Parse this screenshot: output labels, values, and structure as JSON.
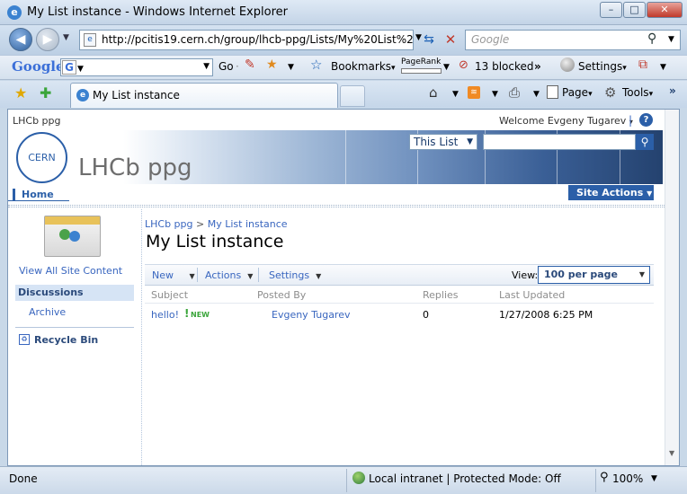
{
  "window": {
    "title": "My List instance - Windows Internet Explorer"
  },
  "nav": {
    "url": "http://pcitis19.cern.ch/group/lhcb-ppg/Lists/My%20List%20ir",
    "search_placeholder": "Google"
  },
  "google_toolbar": {
    "logo": "Google",
    "go_label": "Go",
    "bookmarks_label": "Bookmarks",
    "pagerank_label": "PageRank",
    "blocked_label": "13 blocked",
    "settings_label": "Settings"
  },
  "tabs": {
    "active_tab": "My List instance",
    "page_label": "Page",
    "tools_label": "Tools"
  },
  "site": {
    "top_title": "LHCb ppg",
    "welcome": "Welcome Evgeny Tugarev",
    "logo_text": "CERN",
    "site_title": "LHCb ppg",
    "search_scope": "This List",
    "home_tab": "Home",
    "site_actions": "Site Actions"
  },
  "quicklaunch": {
    "view_all": "View All Site Content",
    "discussions": "Discussions",
    "archive": "Archive",
    "recycle_bin": "Recycle Bin"
  },
  "main": {
    "breadcrumb_site": "LHCb ppg",
    "breadcrumb_sep": ">",
    "breadcrumb_list": "My List instance",
    "page_title": "My List instance",
    "toolbar": {
      "new": "New",
      "actions": "Actions",
      "settings": "Settings",
      "view_label": "View:",
      "view_value": "100 per page"
    },
    "columns": [
      "Subject",
      "Posted By",
      "Replies",
      "Last Updated"
    ],
    "rows": [
      {
        "subject": "hello!",
        "badge": "NEW",
        "posted_by": "Evgeny Tugarev",
        "replies": "0",
        "last_updated": "1/27/2008 6:25 PM"
      }
    ]
  },
  "status": {
    "left": "Done",
    "zone": "Local intranet | Protected Mode: Off",
    "zoom": "100%"
  }
}
